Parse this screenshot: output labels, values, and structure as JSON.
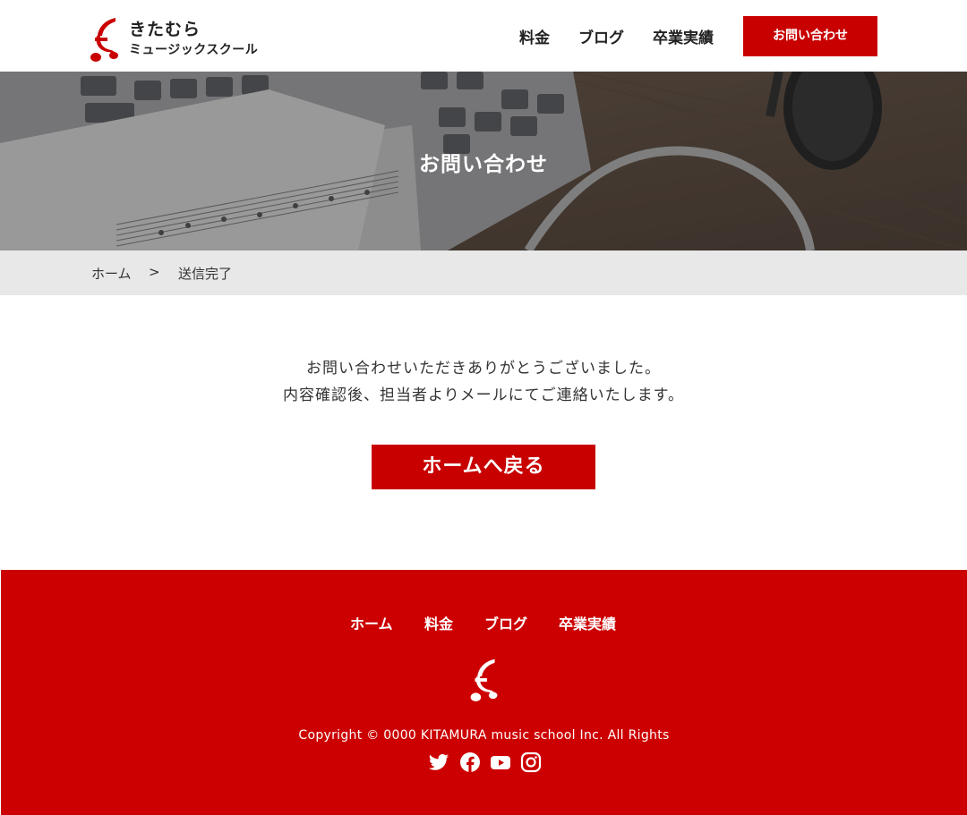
{
  "header": {
    "logo": {
      "line1": "きたむら",
      "line2": "ミュージックスクール"
    },
    "nav": [
      "料金",
      "ブログ",
      "卒業実績"
    ],
    "cta_label": "お問い合わせ"
  },
  "hero": {
    "title": "お問い合わせ"
  },
  "breadcrumb": {
    "home": "ホーム",
    "separator": ">",
    "current": "送信完了"
  },
  "main": {
    "message_line1": "お問い合わせいただきありがとうございました。",
    "message_line2": "内容確認後、担当者よりメールにてご連絡いたします。",
    "home_button_label": "ホームへ戻る"
  },
  "footer": {
    "nav": [
      "ホーム",
      "料金",
      "ブログ",
      "卒業実績"
    ],
    "copyright": "Copyright © 0000 KITAMURA music school Inc. All Rights",
    "social_icons": [
      "twitter-icon",
      "facebook-icon",
      "youtube-icon",
      "instagram-icon"
    ]
  },
  "colors": {
    "brand_red": "#c80000",
    "breadcrumb_bg": "#e8e8e8"
  }
}
